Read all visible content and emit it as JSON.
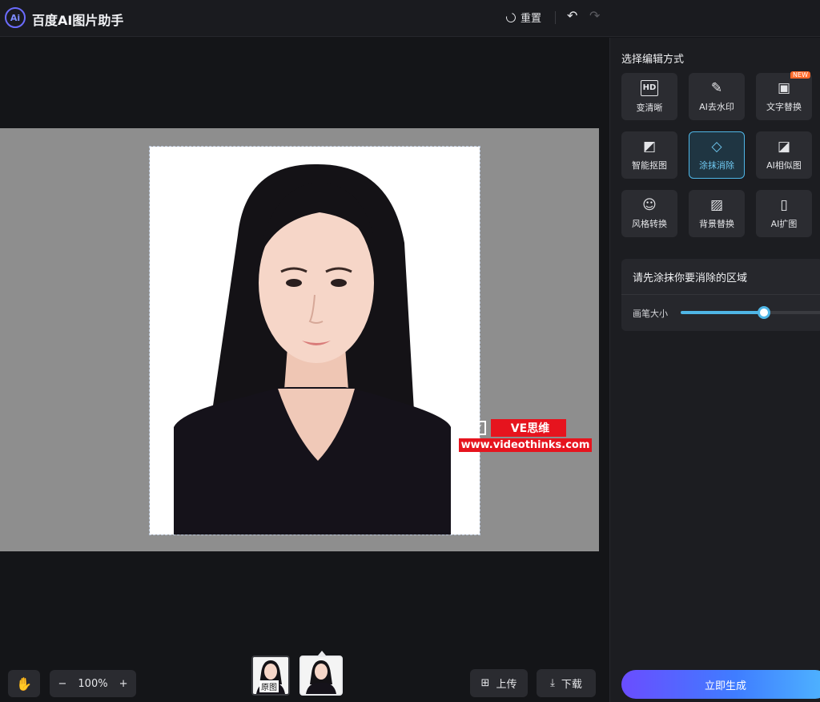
{
  "app": {
    "logo_text": "Ai",
    "title": "百度AI图片助手"
  },
  "toolbar": {
    "reset_label": "重置",
    "undo_icon": "undo-icon",
    "redo_icon": "redo-icon"
  },
  "canvas": {
    "watermark_line1": "VE思维",
    "watermark_line2": "www.videothinks.com",
    "check_glyph": "✓"
  },
  "bottom": {
    "hand_icon": "✋",
    "zoom_out": "−",
    "zoom_level": "100%",
    "zoom_in": "+",
    "thumb_original_label": "原图",
    "upload_label": "上传",
    "download_label": "下载"
  },
  "panel": {
    "title": "选择编辑方式",
    "tools": [
      {
        "label": "变清晰",
        "icon": "HD"
      },
      {
        "label": "AI去水印",
        "icon": "✎"
      },
      {
        "label": "文字替换",
        "icon": "▣",
        "badge": "NEW"
      },
      {
        "label": "智能抠图",
        "icon": "◩"
      },
      {
        "label": "涂抹消除",
        "icon": "◇"
      },
      {
        "label": "AI相似图",
        "icon": "◪"
      },
      {
        "label": "风格转换",
        "icon": "☺"
      },
      {
        "label": "背景替换",
        "icon": "▨"
      },
      {
        "label": "AI扩图",
        "icon": "▯"
      }
    ],
    "active_tool_index": 4,
    "hint": "请先涂抹你要消除的区域",
    "brush_label": "画笔大小",
    "brush_size_fraction": 0.58,
    "generate_label": "立即生成"
  },
  "colors": {
    "accent": "#4fb6e6",
    "badge": "#ff6a2a",
    "watermark_red": "#e6141e"
  }
}
